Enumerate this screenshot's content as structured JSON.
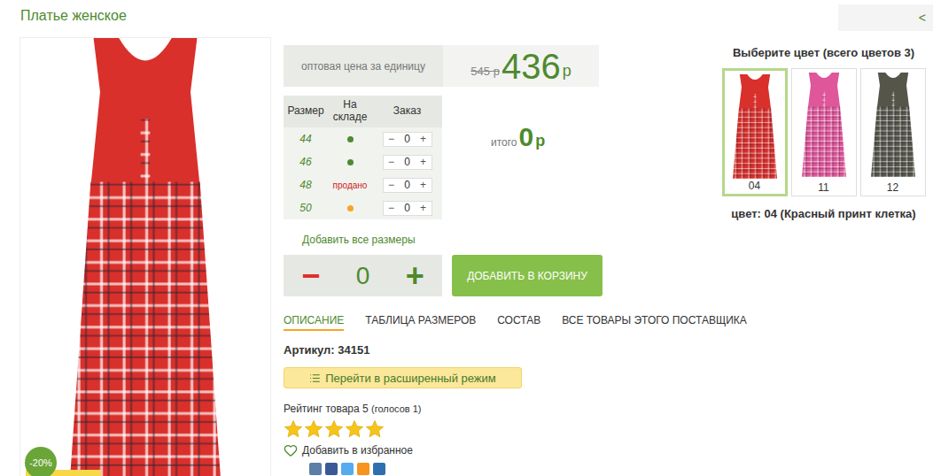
{
  "title": "Платье женское",
  "nav": {
    "label": "<"
  },
  "product_image": {
    "discount": "-20%"
  },
  "price": {
    "label": "оптовая цена за единицу",
    "old": "545 р",
    "current": "436",
    "currency": "р"
  },
  "sizes": {
    "columns": [
      "Размер",
      "На складе",
      "Заказ"
    ],
    "stepper": {
      "minus": "−",
      "plus": "+"
    },
    "rows": [
      {
        "size": "44",
        "kind": "dot",
        "label": "",
        "color": "#4e8a2e",
        "qty": "0"
      },
      {
        "size": "46",
        "kind": "dot",
        "label": "",
        "color": "#4e8a2e",
        "qty": "0"
      },
      {
        "size": "48",
        "kind": "text",
        "label": "продано",
        "color": "#d0201a",
        "qty": "0"
      },
      {
        "size": "50",
        "kind": "dot",
        "label": "",
        "color": "#f5a623",
        "qty": "0"
      }
    ]
  },
  "total": {
    "label": "итого",
    "value": "0",
    "currency": "р"
  },
  "add_all": "Добавить все размеры",
  "quantity": {
    "minus": "−",
    "value": "0",
    "plus": "+"
  },
  "add_to_cart": "ДОБАВИТЬ В КОРЗИНУ",
  "tabs": [
    {
      "label": "ОПИСАНИЕ",
      "selected": true
    },
    {
      "label": "ТАБЛИЦА РАЗМЕРОВ",
      "selected": false
    },
    {
      "label": "СОСТАВ",
      "selected": false
    },
    {
      "label": "ВСЕ ТОВАРЫ ЭТОГО ПОСТАВЩИКА",
      "selected": false
    }
  ],
  "article": {
    "label": "Артикул:",
    "value": "34151"
  },
  "advanced_mode": "Перейти в расширенный режим",
  "rating": {
    "label": "Рейтинг товара 5",
    "votes": "(голосов 1)",
    "stars": 5
  },
  "favorite": "Добавить в избранное",
  "share_buttons": [
    {
      "color": "#5b7fa6"
    },
    {
      "color": "#3b5998"
    },
    {
      "color": "#55acee"
    },
    {
      "color": "#f7931e"
    },
    {
      "color": "#2f6fb0"
    }
  ],
  "colors": {
    "title": "Выберите цвет (всего цветов 3)",
    "items": [
      {
        "code": "04",
        "selected": true,
        "color": "#d9302c"
      },
      {
        "code": "11",
        "selected": false,
        "color": "#e0569a"
      },
      {
        "code": "12",
        "selected": false,
        "color": "#55554a"
      }
    ],
    "current": "цвет: 04 (Красный принт клетка)"
  }
}
